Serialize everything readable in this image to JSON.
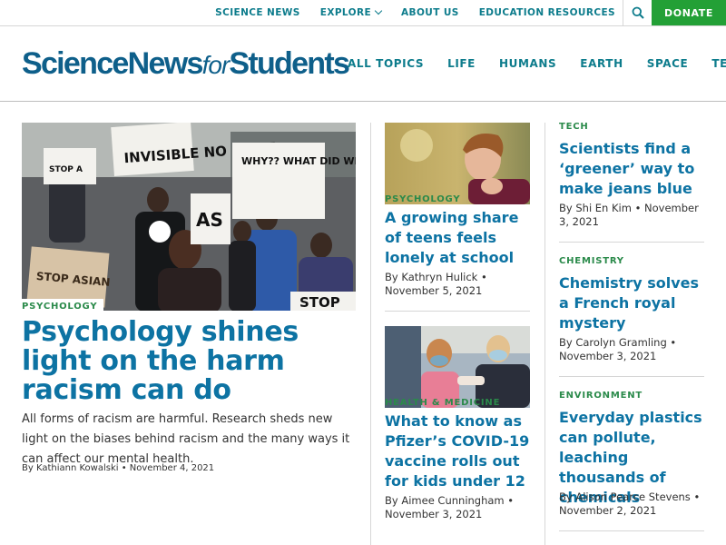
{
  "topbar": {
    "links": [
      "SCIENCE NEWS",
      "EXPLORE",
      "ABOUT US",
      "EDUCATION RESOURCES"
    ],
    "donate": "DONATE"
  },
  "header": {
    "logo_science": "ScienceNews",
    "logo_for": "for",
    "logo_students": "Students",
    "nav": [
      "ALL TOPICS",
      "LIFE",
      "HUMANS",
      "EARTH",
      "SPACE",
      "TECH"
    ]
  },
  "hero": {
    "category": "PSYCHOLOGY",
    "title": "Psychology shines light on the harm racism can do",
    "description": "All forms of racism are harmful. Research sheds new light on the biases behind racism and the many ways it can affect our mental health.",
    "meta": "By Kathiann Kowalski • November 4, 2021",
    "signs": {
      "s1": "INVISIBLE NO MORE",
      "s2": "WHY?? WHAT DID WE DO TO YOU??",
      "s3": "STOP ASIAN",
      "s4": "STOP",
      "s5": "AS",
      "s6": "STOP A"
    }
  },
  "middle": [
    {
      "category": "PSYCHOLOGY",
      "title": "A growing share of teens feels lonely at school",
      "meta": "By Kathryn Hulick • November 5, 2021"
    },
    {
      "category": "HEALTH & MEDICINE",
      "title": "What to know as Pfizer’s COVID-19 vaccine rolls out for kids under 12",
      "meta": "By Aimee Cunningham • November 3, 2021"
    }
  ],
  "right": [
    {
      "category": "TECH",
      "title": "Scientists find a ‘greener’ way to make jeans blue",
      "meta": "By Shi En Kim • November 3, 2021"
    },
    {
      "category": "CHEMISTRY",
      "title": "Chemistry solves a French royal mystery",
      "meta": "By Carolyn Gramling • November 3, 2021"
    },
    {
      "category": "ENVIRONMENT",
      "title": "Everyday plastics can pollute, leaching thousands of chemicals",
      "meta": "By Alison Pearce Stevens • November 2, 2021"
    }
  ],
  "colors": {
    "teal": "#0d7c8c",
    "headline_blue": "#0d73a3",
    "category_green": "#2a8a4a",
    "donate_green": "#23a036",
    "logo_blue": "#0e5f8a"
  }
}
